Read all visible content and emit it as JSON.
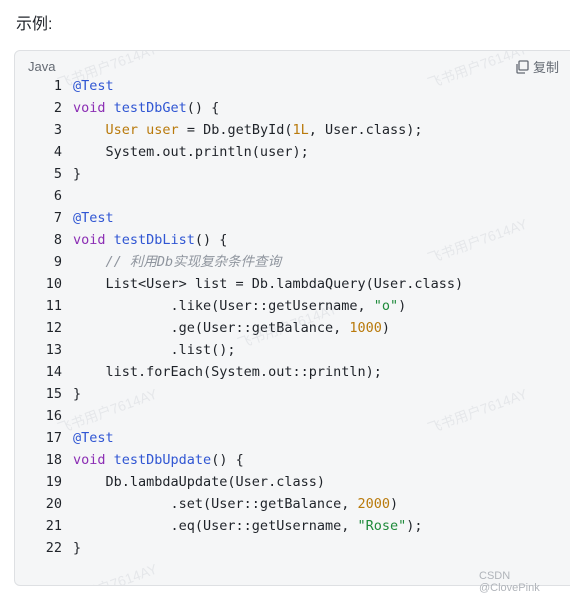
{
  "heading": "示例:",
  "code_block": {
    "language": "Java",
    "copy_label": "复制",
    "lines": [
      {
        "n": "1",
        "tokens": [
          {
            "t": "@Test",
            "c": "an"
          }
        ]
      },
      {
        "n": "2",
        "tokens": [
          {
            "t": "void ",
            "c": "kw"
          },
          {
            "t": "testDbGet",
            "c": "fn"
          },
          {
            "t": "() {",
            "c": ""
          }
        ]
      },
      {
        "n": "3",
        "tokens": [
          {
            "t": "    ",
            "c": ""
          },
          {
            "t": "User",
            "c": "ty"
          },
          {
            "t": " ",
            "c": ""
          },
          {
            "t": "user",
            "c": "ty"
          },
          {
            "t": " = Db.getById(",
            "c": ""
          },
          {
            "t": "1L",
            "c": "num"
          },
          {
            "t": ", User.class);",
            "c": ""
          }
        ]
      },
      {
        "n": "4",
        "tokens": [
          {
            "t": "    System.out.println(user);",
            "c": ""
          }
        ]
      },
      {
        "n": "5",
        "tokens": [
          {
            "t": "}",
            "c": ""
          }
        ]
      },
      {
        "n": "6",
        "tokens": []
      },
      {
        "n": "7",
        "tokens": [
          {
            "t": "@Test",
            "c": "an"
          }
        ]
      },
      {
        "n": "8",
        "tokens": [
          {
            "t": "void ",
            "c": "kw"
          },
          {
            "t": "testDbList",
            "c": "fn"
          },
          {
            "t": "() {",
            "c": ""
          }
        ]
      },
      {
        "n": "9",
        "tokens": [
          {
            "t": "    ",
            "c": ""
          },
          {
            "t": "// 利用Db实现复杂条件查询",
            "c": "cm"
          }
        ]
      },
      {
        "n": "10",
        "tokens": [
          {
            "t": "    List<User> list = Db.lambdaQuery(User.class)",
            "c": ""
          }
        ]
      },
      {
        "n": "11",
        "tokens": [
          {
            "t": "            .like(User::getUsername, ",
            "c": ""
          },
          {
            "t": "\"o\"",
            "c": "str"
          },
          {
            "t": ")",
            "c": ""
          }
        ]
      },
      {
        "n": "12",
        "tokens": [
          {
            "t": "            .ge(User::getBalance, ",
            "c": ""
          },
          {
            "t": "1000",
            "c": "num"
          },
          {
            "t": ")",
            "c": ""
          }
        ]
      },
      {
        "n": "13",
        "tokens": [
          {
            "t": "            .list();",
            "c": ""
          }
        ]
      },
      {
        "n": "14",
        "tokens": [
          {
            "t": "    list.forEach(System.out::println);",
            "c": ""
          }
        ]
      },
      {
        "n": "15",
        "tokens": [
          {
            "t": "}",
            "c": ""
          }
        ]
      },
      {
        "n": "16",
        "tokens": []
      },
      {
        "n": "17",
        "tokens": [
          {
            "t": "@Test",
            "c": "an"
          }
        ]
      },
      {
        "n": "18",
        "tokens": [
          {
            "t": "void ",
            "c": "kw"
          },
          {
            "t": "testDbUpdate",
            "c": "fn"
          },
          {
            "t": "() {",
            "c": ""
          }
        ]
      },
      {
        "n": "19",
        "tokens": [
          {
            "t": "    Db.lambdaUpdate(User.class)",
            "c": ""
          }
        ]
      },
      {
        "n": "20",
        "tokens": [
          {
            "t": "            .set(User::getBalance, ",
            "c": ""
          },
          {
            "t": "2000",
            "c": "num"
          },
          {
            "t": ")",
            "c": ""
          }
        ]
      },
      {
        "n": "21",
        "tokens": [
          {
            "t": "            .eq(User::getUsername, ",
            "c": ""
          },
          {
            "t": "\"Rose\"",
            "c": "str"
          },
          {
            "t": ");",
            "c": ""
          }
        ]
      },
      {
        "n": "22",
        "tokens": [
          {
            "t": "}",
            "c": ""
          }
        ]
      }
    ]
  },
  "watermark_text": "飞书用户7614AY",
  "credit": "CSDN @ClovePink",
  "colors": {
    "annotation": "#3056d3",
    "keyword": "#8b2db4",
    "number": "#b97a0c",
    "string": "#1e8a3a",
    "comment": "#8f959e"
  }
}
